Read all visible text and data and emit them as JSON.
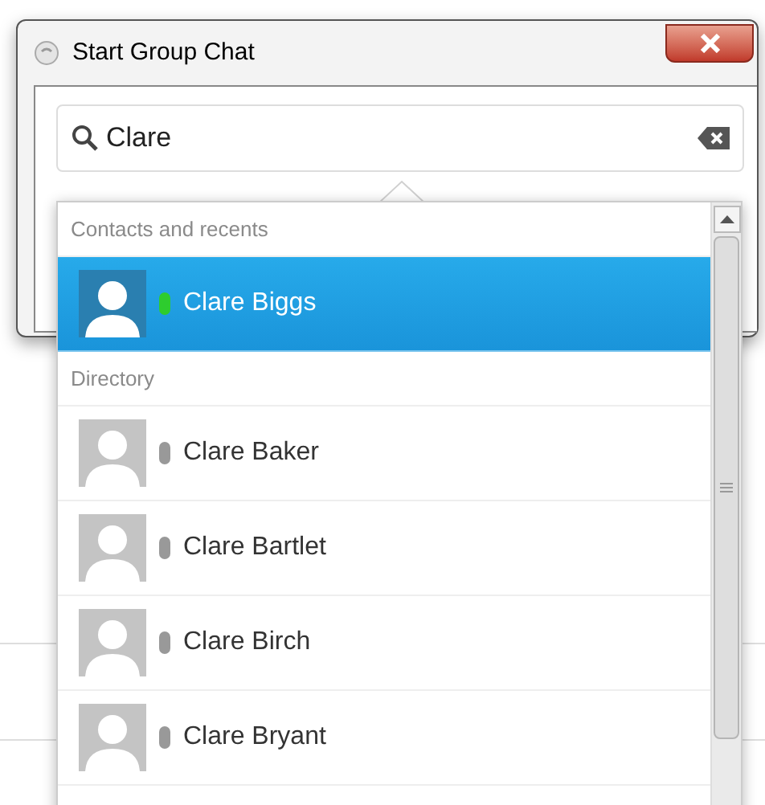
{
  "window": {
    "title": "Start Group Chat"
  },
  "search": {
    "value": "Clare"
  },
  "results": [
    {
      "header": "Contacts and recents",
      "people": [
        {
          "name": "Clare Biggs",
          "selected": true,
          "color": "#2ecc2e"
        }
      ]
    },
    {
      "header": "Directory",
      "people": [
        {
          "name": "Clare Baker",
          "selected": false,
          "color": "#999999"
        },
        {
          "name": "Clare Bartlet",
          "selected": false,
          "color": "#999999"
        },
        {
          "name": "Clare Birch",
          "selected": false,
          "color": "#999999"
        },
        {
          "name": "Clare Bryant",
          "selected": false,
          "color": "#999999"
        }
      ]
    }
  ]
}
